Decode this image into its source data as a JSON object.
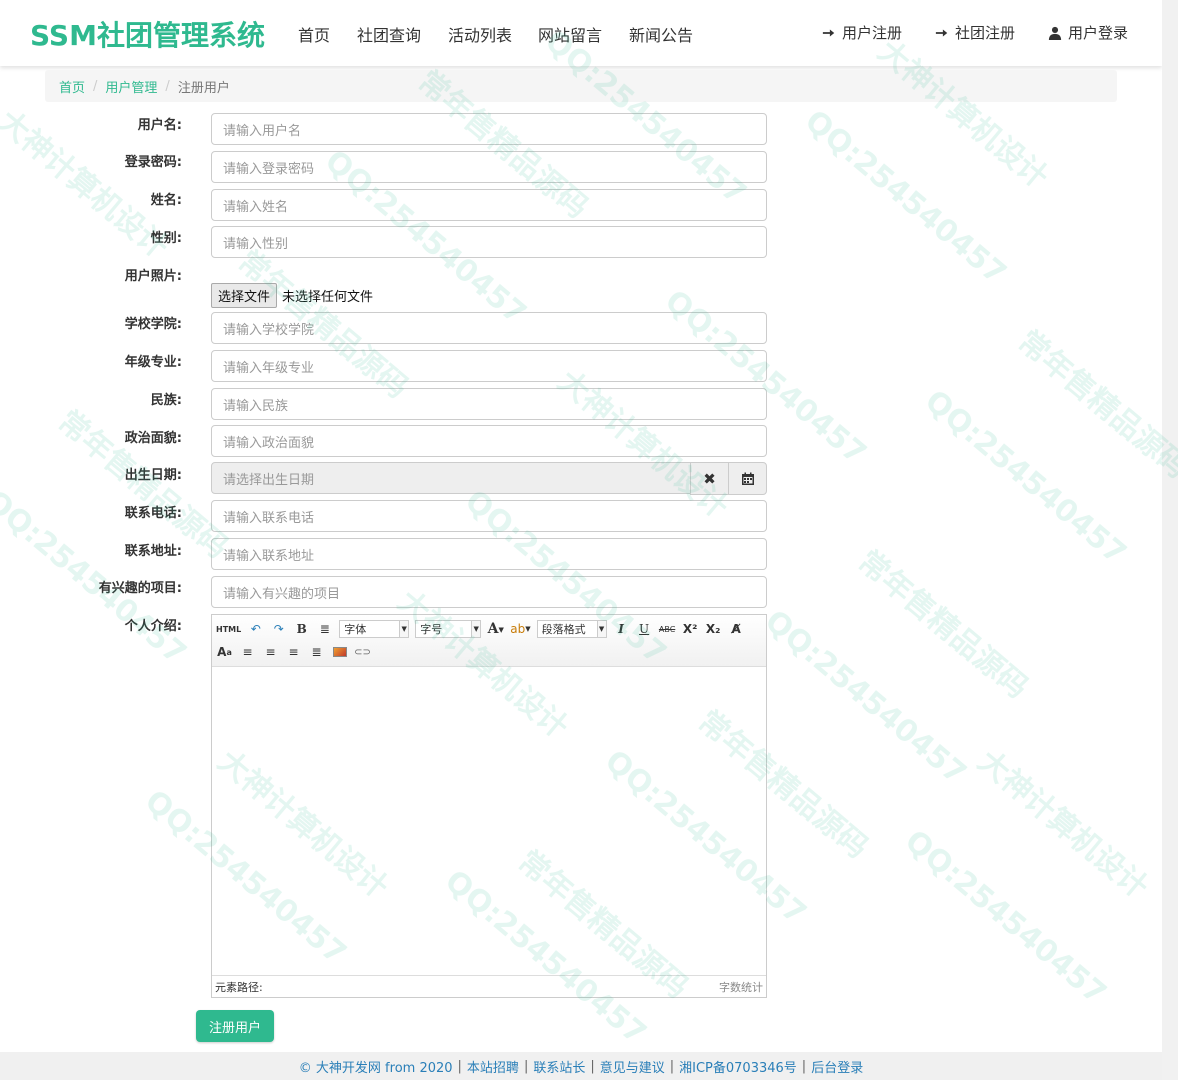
{
  "brand": "SSM社团管理系统",
  "nav": {
    "items": [
      "首页",
      "社团查询",
      "活动列表",
      "网站留言",
      "新闻公告"
    ],
    "right": [
      "用户注册",
      "社团注册",
      "用户登录"
    ]
  },
  "breadcrumb": {
    "home": "首页",
    "section": "用户管理",
    "current": "注册用户",
    "separator": "/"
  },
  "form": {
    "fields": [
      {
        "label": "用户名:",
        "placeholder": "请输入用户名"
      },
      {
        "label": "登录密码:",
        "placeholder": "请输入登录密码"
      },
      {
        "label": "姓名:",
        "placeholder": "请输入姓名"
      },
      {
        "label": "性别:",
        "placeholder": "请输入性别"
      },
      {
        "label": "学校学院:",
        "placeholder": "请输入学校学院"
      },
      {
        "label": "年级专业:",
        "placeholder": "请输入年级专业"
      },
      {
        "label": "民族:",
        "placeholder": "请输入民族"
      },
      {
        "label": "政治面貌:",
        "placeholder": "请输入政治面貌"
      },
      {
        "label": "出生日期:",
        "placeholder": "请选择出生日期"
      },
      {
        "label": "联系电话:",
        "placeholder": "请输入联系电话"
      },
      {
        "label": "联系地址:",
        "placeholder": "请输入联系地址"
      },
      {
        "label": "有兴趣的项目:",
        "placeholder": "请输入有兴趣的项目"
      }
    ],
    "photo": {
      "label": "用户照片:",
      "button": "选择文件",
      "status": "未选择任何文件"
    },
    "intro_label": "个人介绍:",
    "submit": "注册用户"
  },
  "editor": {
    "toolbar_row1": [
      "HTML",
      "↶",
      "↷",
      "B",
      "≣"
    ],
    "font_select": "字体",
    "size_select": "字号",
    "paragraph_select": "段落格式",
    "toolbar_row1_end": [
      "I",
      "U",
      "ABC",
      "X²",
      "X₂",
      "A̸"
    ],
    "path_label": "元素路径:",
    "count_label": "字数统计"
  },
  "footer": {
    "copyright": "© 大神开发网 from 2020",
    "links": [
      "本站招聘",
      "联系站长",
      "意见与建议",
      "湘ICP备0703346号",
      "后台登录"
    ]
  },
  "watermark": [
    "大神计算机设计",
    "QQ:254540457",
    "常年售精品源码"
  ],
  "colors": {
    "accent": "#2fb98f",
    "link": "#2a7fb8"
  }
}
